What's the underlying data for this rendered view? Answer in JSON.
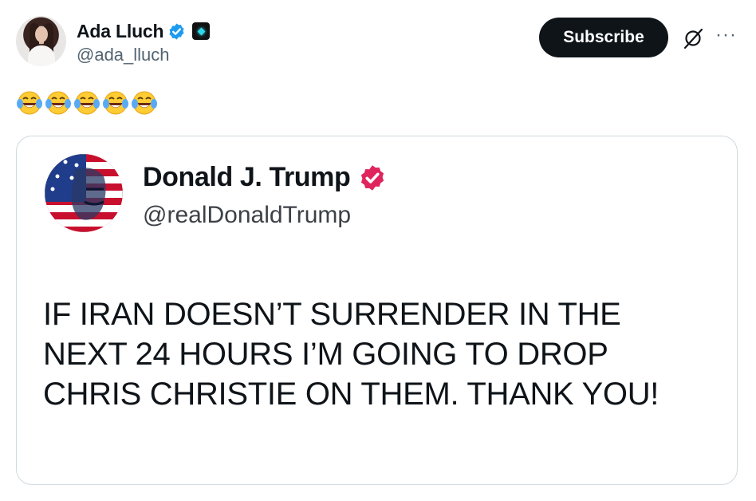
{
  "author": {
    "name": "Ada Lluch",
    "handle": "@ada_lluch",
    "verified": true,
    "badge_color": "#1d9bf0"
  },
  "actions": {
    "subscribe_label": "Subscribe",
    "grok_icon": "grok-icon",
    "more_icon": "more-icon"
  },
  "post": {
    "emojis": [
      "😂",
      "😂",
      "😂",
      "😂",
      "😂"
    ]
  },
  "quoted": {
    "name": "Donald J. Trump",
    "handle": "@realDonaldTrump",
    "verified_color": "#e0245e",
    "lines": [
      "IF IRAN DOESN’T SURRENDER IN THE",
      "NEXT 24 HOURS I’M GOING TO DROP",
      "CHRIS CHRISTIE ON THEM. THANK YOU!"
    ]
  }
}
